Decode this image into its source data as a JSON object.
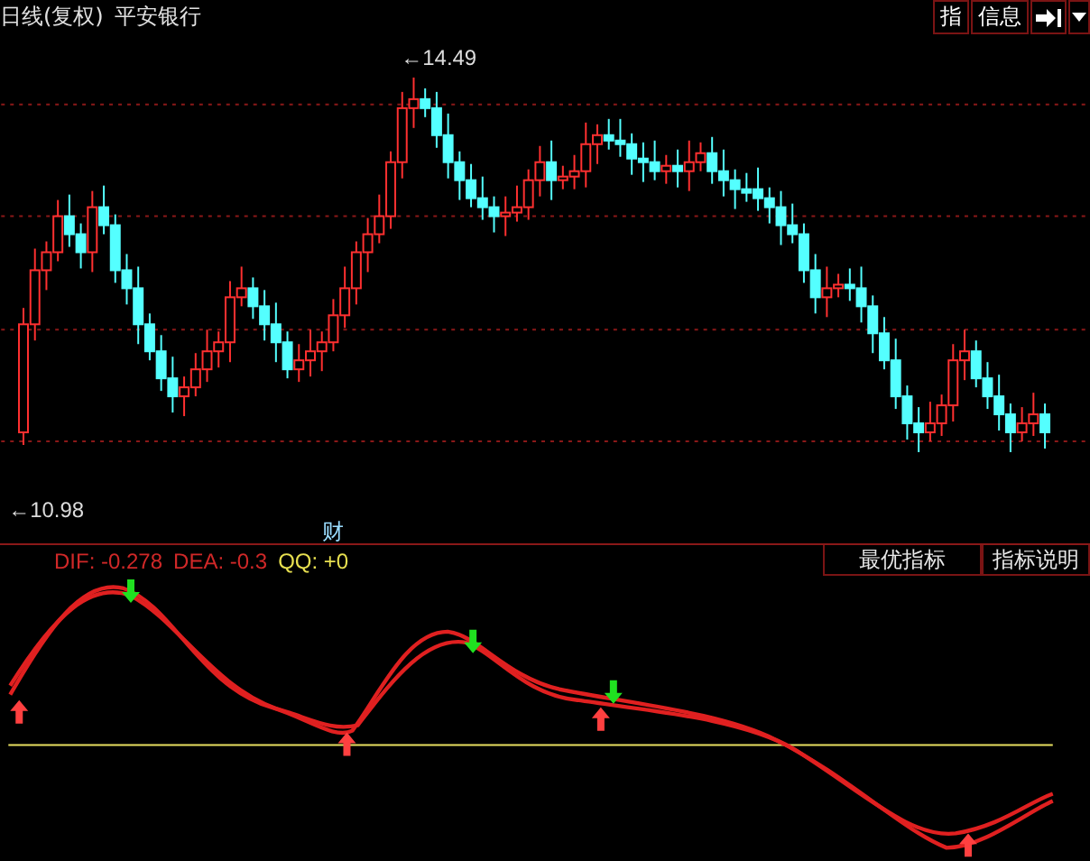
{
  "header": {
    "period": "日线(复权)",
    "stock": "平安银行",
    "buttons": [
      {
        "label": "指"
      },
      {
        "label": "信息"
      }
    ]
  },
  "price_chart": {
    "high_label": "←14.49",
    "low_label": "←10.98",
    "badge": "财"
  },
  "indicator": {
    "values": [
      {
        "text": "DIF: -0.278",
        "color": "#d02828"
      },
      {
        "text": "DEA: -0.3",
        "color": "#d02828"
      },
      {
        "text": "QQ: +0",
        "color": "#e8e050"
      }
    ],
    "buttons": [
      "最优指标",
      "指标说明"
    ]
  }
}
